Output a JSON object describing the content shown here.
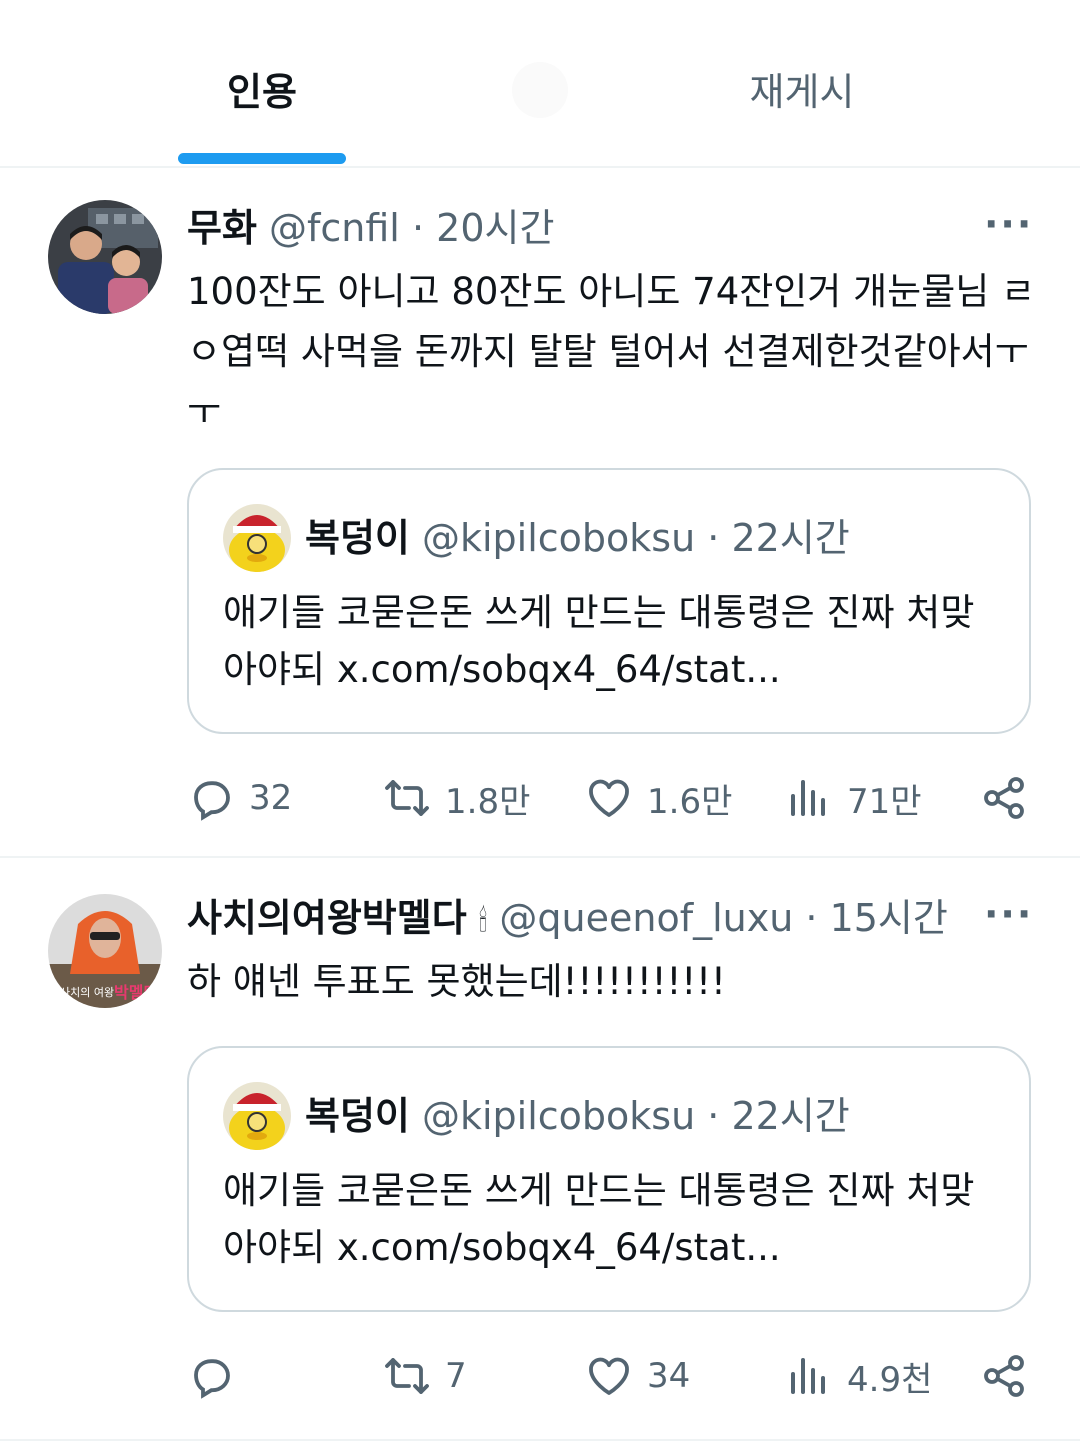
{
  "tabs": [
    {
      "label": "인용",
      "active": true
    },
    {
      "label": "재게시",
      "active": false
    }
  ],
  "colors": {
    "accent": "#1d9bf0",
    "text": "#0f1419",
    "secondary": "#536471",
    "border": "#cfd9de"
  },
  "tweets": [
    {
      "display_name": "무화",
      "handle": "@fcnfil",
      "time": "20시간",
      "text": "100잔도 아니고 80잔도 아니도 74잔인거 개눈물님 ㄹㅇ엽떡 사먹을 돈까지 탈탈 털어서 선결제한것같아서ㅜㅜ",
      "quote": {
        "display_name": "복덩이",
        "handle": "@kipilcoboksu",
        "time": "22시간",
        "text": "애기들 코묻은돈 쓰게 만드는 대통령은 진짜 처맞아야되 x.com/sobqx4_64/stat..."
      },
      "stats": {
        "replies": "32",
        "reposts": "1.8만",
        "likes": "1.6만",
        "views": "71만"
      }
    },
    {
      "display_name": "사치의여왕박멜다",
      "emoji": "🕯",
      "handle": "@queenof_luxu",
      "time": "15시간",
      "text": "하 얘넨 투표도 못했는데!!!!!!!!!!!",
      "quote": {
        "display_name": "복덩이",
        "handle": "@kipilcoboksu",
        "time": "22시간",
        "text": "애기들 코묻은돈 쓰게 만드는 대통령은 진짜 처맞아야되 x.com/sobqx4_64/stat..."
      },
      "stats": {
        "replies": "",
        "reposts": "7",
        "likes": "34",
        "views": "4.9천"
      }
    }
  ],
  "icons": {
    "more": "more-icon",
    "reply": "reply-icon",
    "repost": "repost-icon",
    "like": "heart-icon",
    "views": "views-icon",
    "share": "share-icon"
  }
}
